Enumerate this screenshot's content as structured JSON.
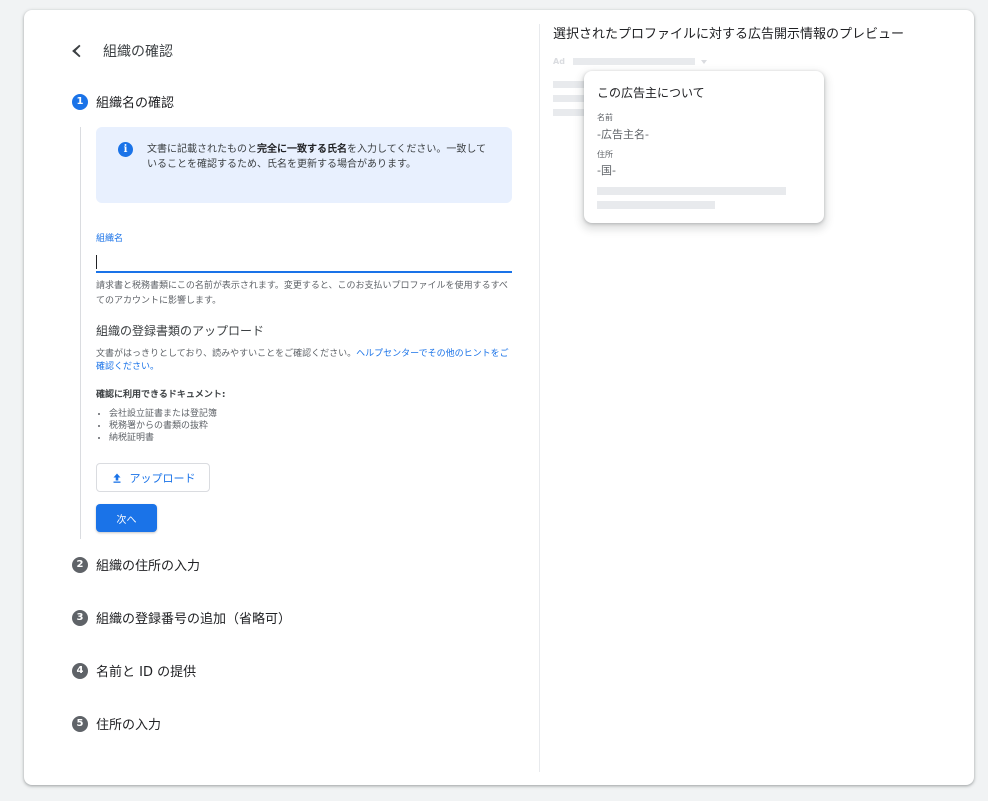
{
  "header": {
    "title": "組織の確認"
  },
  "colors": {
    "accent": "#1a73e8",
    "step_inactive": "#5f6368",
    "info_bg": "#e8f0fe"
  },
  "steps": [
    {
      "number": "1",
      "label": "組織名の確認",
      "active": true
    },
    {
      "number": "2",
      "label": "組織の住所の入力",
      "active": false
    },
    {
      "number": "3",
      "label": "組織の登録番号の追加（省略可）",
      "active": false
    },
    {
      "number": "4",
      "label": "名前と ID の提供",
      "active": false
    },
    {
      "number": "5",
      "label": "住所の入力",
      "active": false
    }
  ],
  "info": {
    "icon": "info-icon",
    "text_before": "文書に記載されたものと",
    "text_bold": "完全に一致する氏名",
    "text_after": "を入力してください。一致していることを確認するため、氏名を更新する場合があります。"
  },
  "form": {
    "org_name_label": "組織名",
    "org_name_value": "",
    "helper": "請求書と税務書類にこの名前が表示されます。変更すると、このお支払いプロファイルを使用するすべてのアカウントに影響します。"
  },
  "upload": {
    "section_title": "組織の登録書類のアップロード",
    "desc": "文書がはっきりとしており、読みやすいことをご確認ください。",
    "help_link": "ヘルプセンターでその他のヒントをご確認ください。",
    "docs_title": "確認に利用できるドキュメント:",
    "docs": [
      "会社設立証書または登記簿",
      "税務署からの書類の抜粋",
      "納税証明書"
    ],
    "button_label": "アップロード",
    "button_icon": "upload-icon"
  },
  "next_button": "次へ",
  "preview": {
    "title": "選択されたプロファイルに対する広告開示情報のプレビュー",
    "ad_label": "Ad",
    "card_title": "この広告主について",
    "name_label": "名前",
    "name_value": "-広告主名-",
    "location_label": "住所",
    "location_value": "-国-"
  }
}
